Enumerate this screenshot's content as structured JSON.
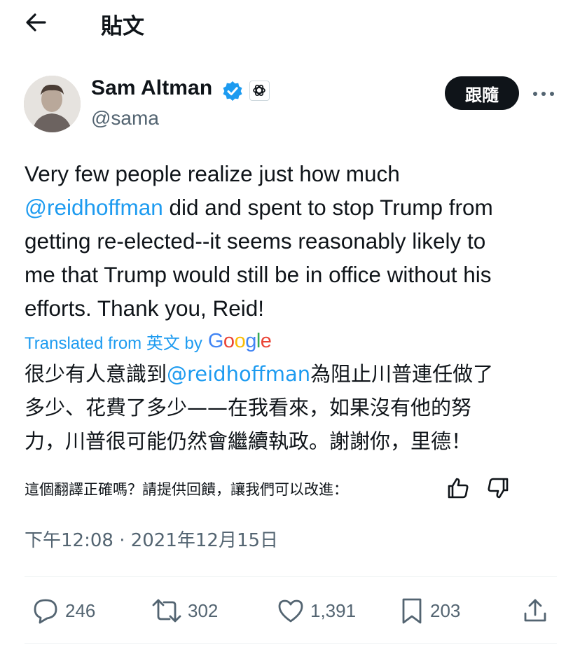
{
  "header": {
    "title": "貼文",
    "back_icon": "arrow-left-icon"
  },
  "author": {
    "name": "Sam Altman",
    "handle": "@sama",
    "verified_icon": "verified-badge-icon",
    "affiliation_icon": "openai-logo-icon",
    "follow_label": "跟隨"
  },
  "tweet": {
    "line1": "Very few people realize just how much",
    "mention": "@reidhoffman",
    "line2_rest": " did and spent to stop Trump from",
    "line3": "getting re-elected--it seems reasonably likely to",
    "line4": "me that Trump would still be in office without his",
    "line5": "efforts. Thank you, Reid!"
  },
  "translation": {
    "prefix": "Translated from 英文 by",
    "provider": "Google",
    "line1_pre": "很少有人意識到",
    "mention": "@reidhoffman",
    "line1_post": "為阻止川普連任做了",
    "line2": "多少、花費了多少——在我看來，如果沒有他的努",
    "line3": "力，川普很可能仍然會繼續執政。謝謝你，里德！",
    "feedback_prompt": "這個翻譯正確嗎？請提供回饋，讓我們可以改進："
  },
  "timestamp": "下午12:08 · 2021年12月15日",
  "actions": {
    "replies": "246",
    "reposts": "302",
    "likes": "1,391",
    "bookmarks": "203"
  },
  "colors": {
    "accent": "#1d9bf0",
    "text": "#0f1419",
    "secondary": "#536471",
    "button_bg": "#0f1419"
  }
}
